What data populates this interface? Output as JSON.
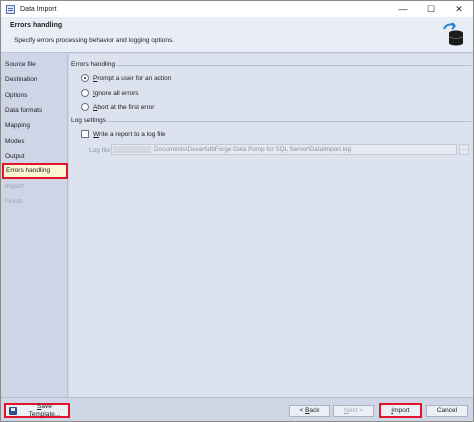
{
  "window": {
    "title": "Data Import",
    "controls": {
      "minimize": "—",
      "maximize": "☐",
      "close": "✕"
    }
  },
  "header": {
    "title": "Errors handling",
    "subtitle": "Specify errors processing behavior and logging options."
  },
  "sidebar": {
    "items": [
      {
        "label": "Source file",
        "state": "normal"
      },
      {
        "label": "Destination",
        "state": "normal"
      },
      {
        "label": "Options",
        "state": "normal"
      },
      {
        "label": "Data formats",
        "state": "normal"
      },
      {
        "label": "Mapping",
        "state": "normal"
      },
      {
        "label": "Modes",
        "state": "normal"
      },
      {
        "label": "Output",
        "state": "normal"
      },
      {
        "label": "Errors handling",
        "state": "active"
      },
      {
        "label": "Import",
        "state": "disabled"
      },
      {
        "label": "Finish",
        "state": "disabled"
      }
    ]
  },
  "errors_handling": {
    "group_label": "Errors handling",
    "options": [
      {
        "accel": "P",
        "rest": "rompt a user for an action",
        "selected": true
      },
      {
        "accel": "I",
        "rest": "gnore all errors",
        "selected": false
      },
      {
        "accel": "A",
        "rest": "bort at the first error",
        "selected": false
      }
    ]
  },
  "log_settings": {
    "group_label": "Log settings",
    "write_report": {
      "accel": "W",
      "rest": "rite a report to a log file",
      "checked": false
    },
    "log_file_label": "Log file:",
    "log_file_value": "Documents\\Devart\\dbForge Data Pump for SQL Server\\DataImport.log",
    "browse_label": "..."
  },
  "footer": {
    "save_template": {
      "accel": "S",
      "rest": "ave Template..."
    },
    "back": {
      "prefix": "< ",
      "accel": "B",
      "rest": "ack"
    },
    "next": {
      "accel": "N",
      "rest": "ext >"
    },
    "import": {
      "accel": "I",
      "rest": "mport"
    },
    "cancel": "Cancel"
  },
  "colors": {
    "highlight_border": "#e0152b",
    "active_item_bg": "#fbf6d2",
    "sidebar_bg": "#cdd5e6",
    "panel_bg": "#dce2ee"
  }
}
